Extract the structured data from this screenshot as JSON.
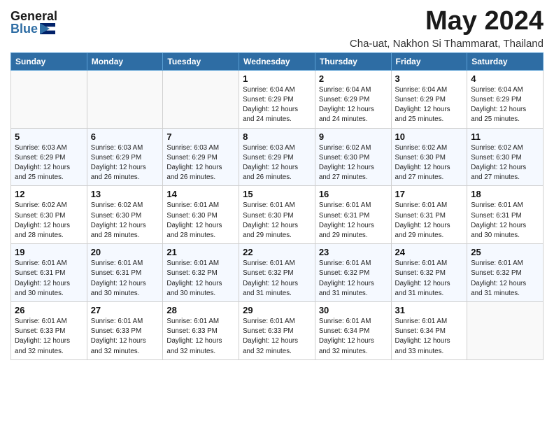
{
  "logo": {
    "general": "General",
    "blue": "Blue"
  },
  "title": "May 2024",
  "location": "Cha-uat, Nakhon Si Thammarat, Thailand",
  "weekdays": [
    "Sunday",
    "Monday",
    "Tuesday",
    "Wednesday",
    "Thursday",
    "Friday",
    "Saturday"
  ],
  "weeks": [
    [
      {
        "day": "",
        "info": ""
      },
      {
        "day": "",
        "info": ""
      },
      {
        "day": "",
        "info": ""
      },
      {
        "day": "1",
        "info": "Sunrise: 6:04 AM\nSunset: 6:29 PM\nDaylight: 12 hours\nand 24 minutes."
      },
      {
        "day": "2",
        "info": "Sunrise: 6:04 AM\nSunset: 6:29 PM\nDaylight: 12 hours\nand 24 minutes."
      },
      {
        "day": "3",
        "info": "Sunrise: 6:04 AM\nSunset: 6:29 PM\nDaylight: 12 hours\nand 25 minutes."
      },
      {
        "day": "4",
        "info": "Sunrise: 6:04 AM\nSunset: 6:29 PM\nDaylight: 12 hours\nand 25 minutes."
      }
    ],
    [
      {
        "day": "5",
        "info": "Sunrise: 6:03 AM\nSunset: 6:29 PM\nDaylight: 12 hours\nand 25 minutes."
      },
      {
        "day": "6",
        "info": "Sunrise: 6:03 AM\nSunset: 6:29 PM\nDaylight: 12 hours\nand 26 minutes."
      },
      {
        "day": "7",
        "info": "Sunrise: 6:03 AM\nSunset: 6:29 PM\nDaylight: 12 hours\nand 26 minutes."
      },
      {
        "day": "8",
        "info": "Sunrise: 6:03 AM\nSunset: 6:29 PM\nDaylight: 12 hours\nand 26 minutes."
      },
      {
        "day": "9",
        "info": "Sunrise: 6:02 AM\nSunset: 6:30 PM\nDaylight: 12 hours\nand 27 minutes."
      },
      {
        "day": "10",
        "info": "Sunrise: 6:02 AM\nSunset: 6:30 PM\nDaylight: 12 hours\nand 27 minutes."
      },
      {
        "day": "11",
        "info": "Sunrise: 6:02 AM\nSunset: 6:30 PM\nDaylight: 12 hours\nand 27 minutes."
      }
    ],
    [
      {
        "day": "12",
        "info": "Sunrise: 6:02 AM\nSunset: 6:30 PM\nDaylight: 12 hours\nand 28 minutes."
      },
      {
        "day": "13",
        "info": "Sunrise: 6:02 AM\nSunset: 6:30 PM\nDaylight: 12 hours\nand 28 minutes."
      },
      {
        "day": "14",
        "info": "Sunrise: 6:01 AM\nSunset: 6:30 PM\nDaylight: 12 hours\nand 28 minutes."
      },
      {
        "day": "15",
        "info": "Sunrise: 6:01 AM\nSunset: 6:30 PM\nDaylight: 12 hours\nand 29 minutes."
      },
      {
        "day": "16",
        "info": "Sunrise: 6:01 AM\nSunset: 6:31 PM\nDaylight: 12 hours\nand 29 minutes."
      },
      {
        "day": "17",
        "info": "Sunrise: 6:01 AM\nSunset: 6:31 PM\nDaylight: 12 hours\nand 29 minutes."
      },
      {
        "day": "18",
        "info": "Sunrise: 6:01 AM\nSunset: 6:31 PM\nDaylight: 12 hours\nand 30 minutes."
      }
    ],
    [
      {
        "day": "19",
        "info": "Sunrise: 6:01 AM\nSunset: 6:31 PM\nDaylight: 12 hours\nand 30 minutes."
      },
      {
        "day": "20",
        "info": "Sunrise: 6:01 AM\nSunset: 6:31 PM\nDaylight: 12 hours\nand 30 minutes."
      },
      {
        "day": "21",
        "info": "Sunrise: 6:01 AM\nSunset: 6:32 PM\nDaylight: 12 hours\nand 30 minutes."
      },
      {
        "day": "22",
        "info": "Sunrise: 6:01 AM\nSunset: 6:32 PM\nDaylight: 12 hours\nand 31 minutes."
      },
      {
        "day": "23",
        "info": "Sunrise: 6:01 AM\nSunset: 6:32 PM\nDaylight: 12 hours\nand 31 minutes."
      },
      {
        "day": "24",
        "info": "Sunrise: 6:01 AM\nSunset: 6:32 PM\nDaylight: 12 hours\nand 31 minutes."
      },
      {
        "day": "25",
        "info": "Sunrise: 6:01 AM\nSunset: 6:32 PM\nDaylight: 12 hours\nand 31 minutes."
      }
    ],
    [
      {
        "day": "26",
        "info": "Sunrise: 6:01 AM\nSunset: 6:33 PM\nDaylight: 12 hours\nand 32 minutes."
      },
      {
        "day": "27",
        "info": "Sunrise: 6:01 AM\nSunset: 6:33 PM\nDaylight: 12 hours\nand 32 minutes."
      },
      {
        "day": "28",
        "info": "Sunrise: 6:01 AM\nSunset: 6:33 PM\nDaylight: 12 hours\nand 32 minutes."
      },
      {
        "day": "29",
        "info": "Sunrise: 6:01 AM\nSunset: 6:33 PM\nDaylight: 12 hours\nand 32 minutes."
      },
      {
        "day": "30",
        "info": "Sunrise: 6:01 AM\nSunset: 6:34 PM\nDaylight: 12 hours\nand 32 minutes."
      },
      {
        "day": "31",
        "info": "Sunrise: 6:01 AM\nSunset: 6:34 PM\nDaylight: 12 hours\nand 33 minutes."
      },
      {
        "day": "",
        "info": ""
      }
    ]
  ]
}
